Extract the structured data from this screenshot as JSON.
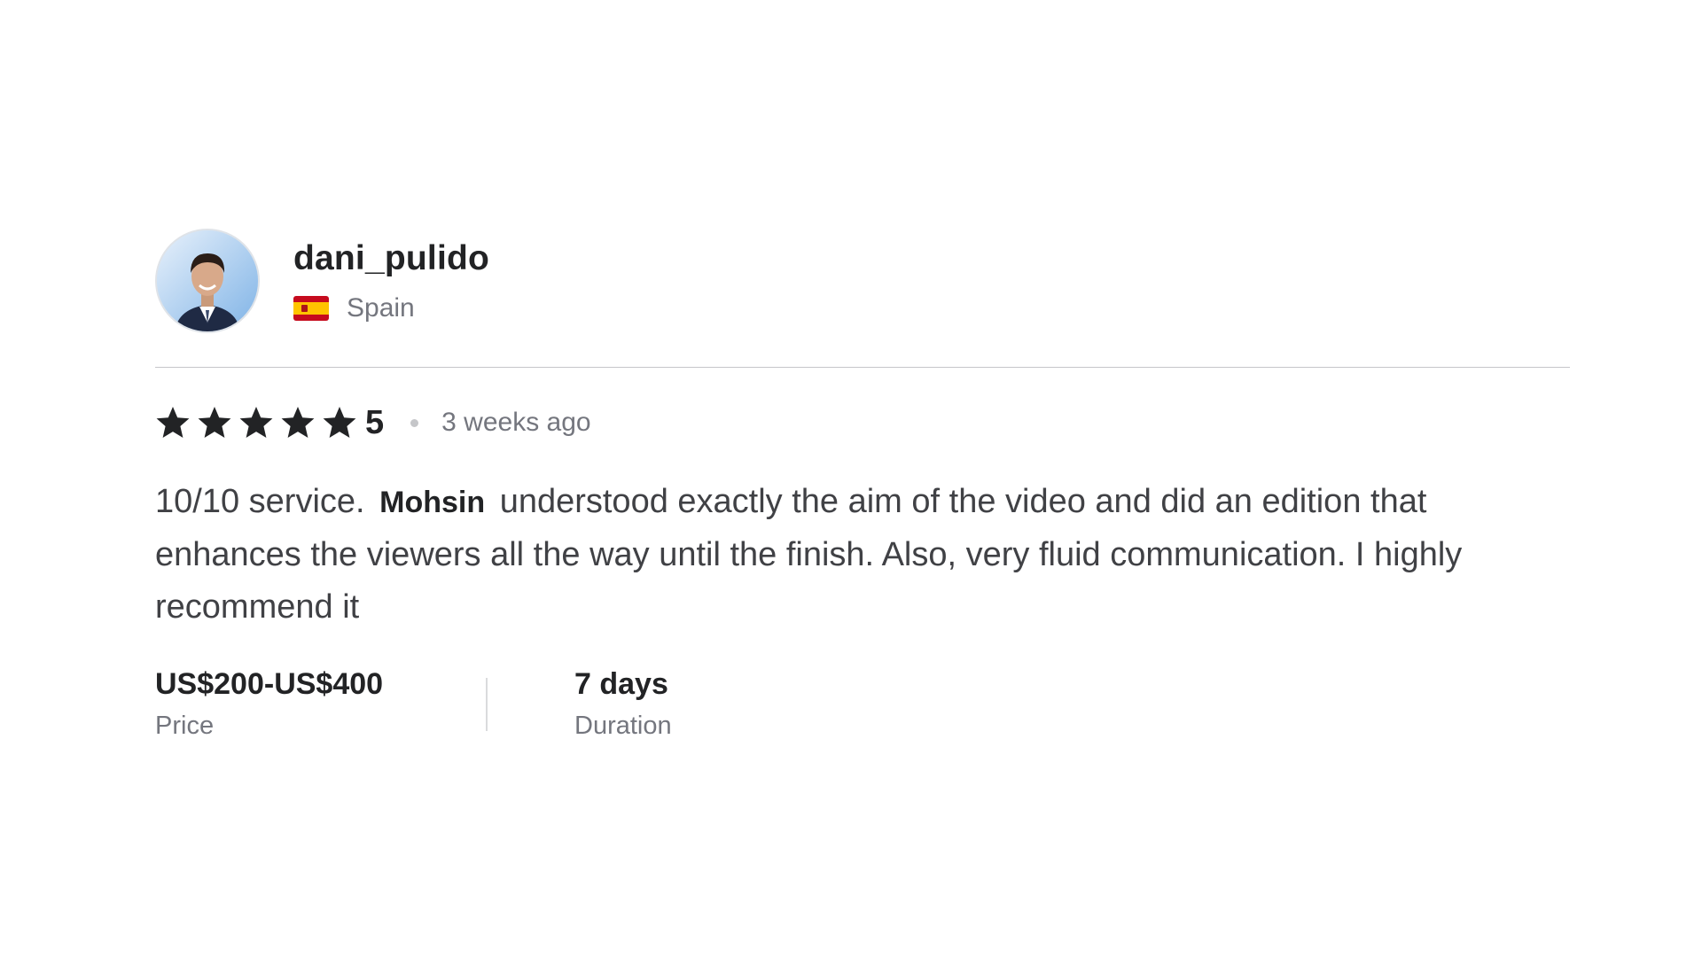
{
  "review": {
    "username": "dani_pulido",
    "country": "Spain",
    "rating": "5",
    "stars": 5,
    "time_ago": "3 weeks ago",
    "text_before": "10/10 service.",
    "mention": "Mohsin",
    "text_after": "understood exactly the aim of the video and did an edition that enhances the viewers all the way until the finish. Also, very fluid communication. I highly recommend it",
    "price": {
      "value": "US$200-US$400",
      "label": "Price"
    },
    "duration": {
      "value": "7 days",
      "label": "Duration"
    }
  },
  "colors": {
    "text_dark": "#222325",
    "text_muted": "#74767e",
    "divider": "#c5c6c9",
    "star": "#222325"
  }
}
